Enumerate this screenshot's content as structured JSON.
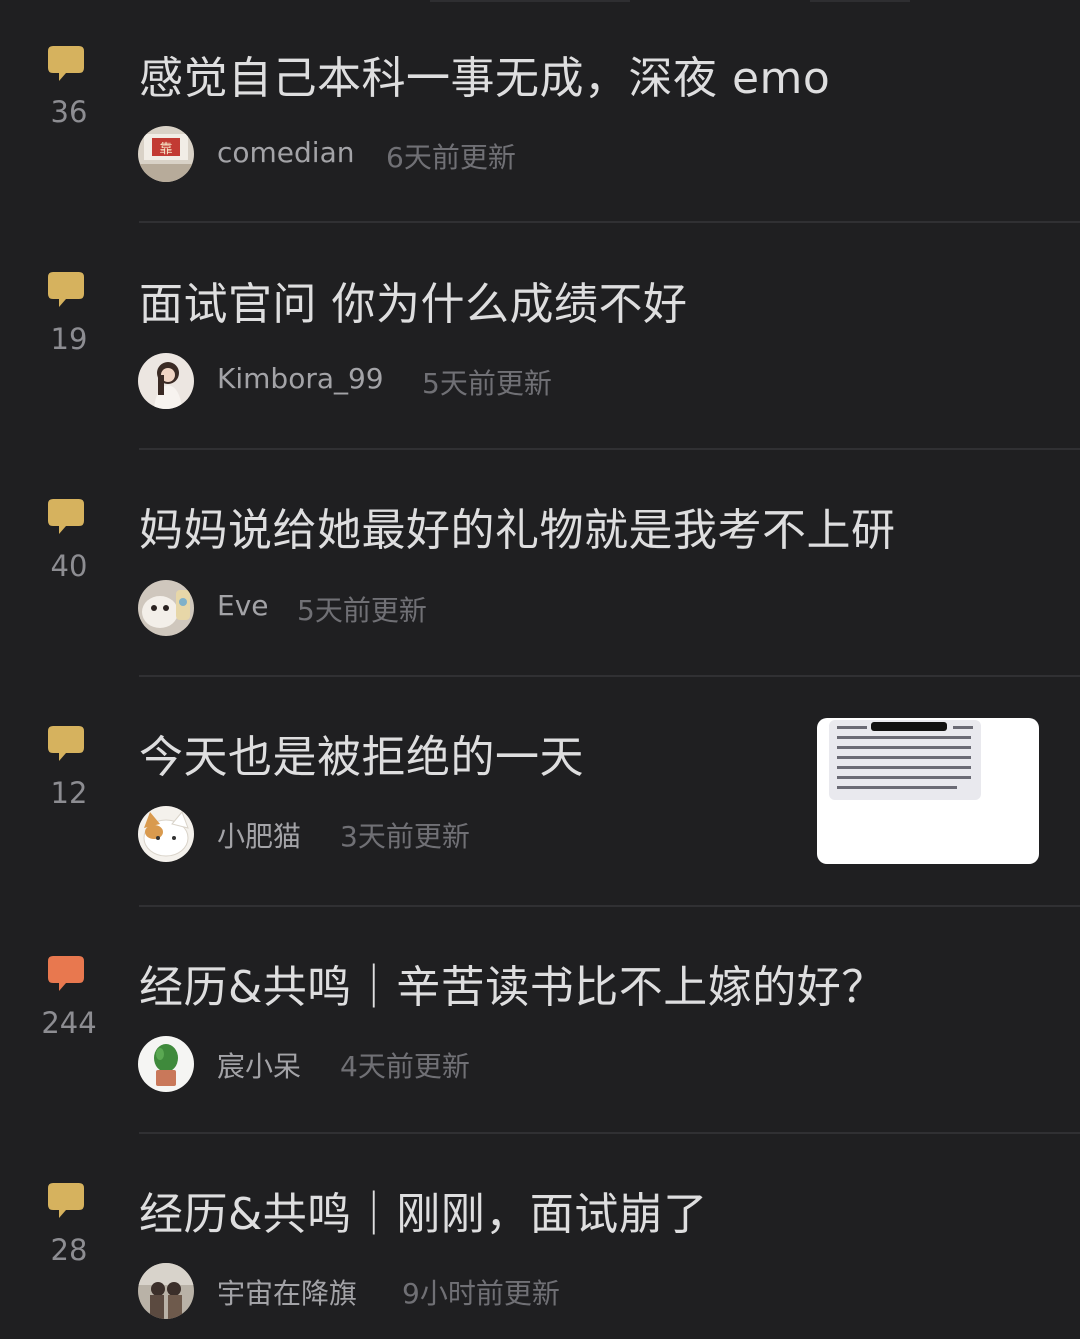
{
  "posts": [
    {
      "comments": "36",
      "title": "感觉自己本科一事无成，深夜 emo",
      "author": "comedian",
      "updated": "6天前更新",
      "bubble_color": "#d6b25e"
    },
    {
      "comments": "19",
      "title": "面试官问 你为什么成绩不好",
      "author": "Kimbora_99",
      "updated": "5天前更新",
      "bubble_color": "#d6b25e"
    },
    {
      "comments": "40",
      "title": "妈妈说给她最好的礼物就是我考不上研",
      "author": "Eve",
      "updated": "5天前更新",
      "bubble_color": "#d6b25e"
    },
    {
      "comments": "12",
      "title": "今天也是被拒绝的一天",
      "author": "小肥猫",
      "updated": "3天前更新",
      "bubble_color": "#d6b25e",
      "has_thumbnail": true
    },
    {
      "comments": "244",
      "title": "经历&共鸣｜辛苦读书比不上嫁的好？",
      "author": "宸小呆",
      "updated": "4天前更新",
      "bubble_color": "#e8784f"
    },
    {
      "comments": "28",
      "title": "经历&共鸣｜刚刚，面试崩了",
      "author": "宇宙在降旗",
      "updated": "9小时前更新",
      "bubble_color": "#d6b25e"
    }
  ],
  "icons": {
    "comment": "speech-bubble-icon"
  }
}
